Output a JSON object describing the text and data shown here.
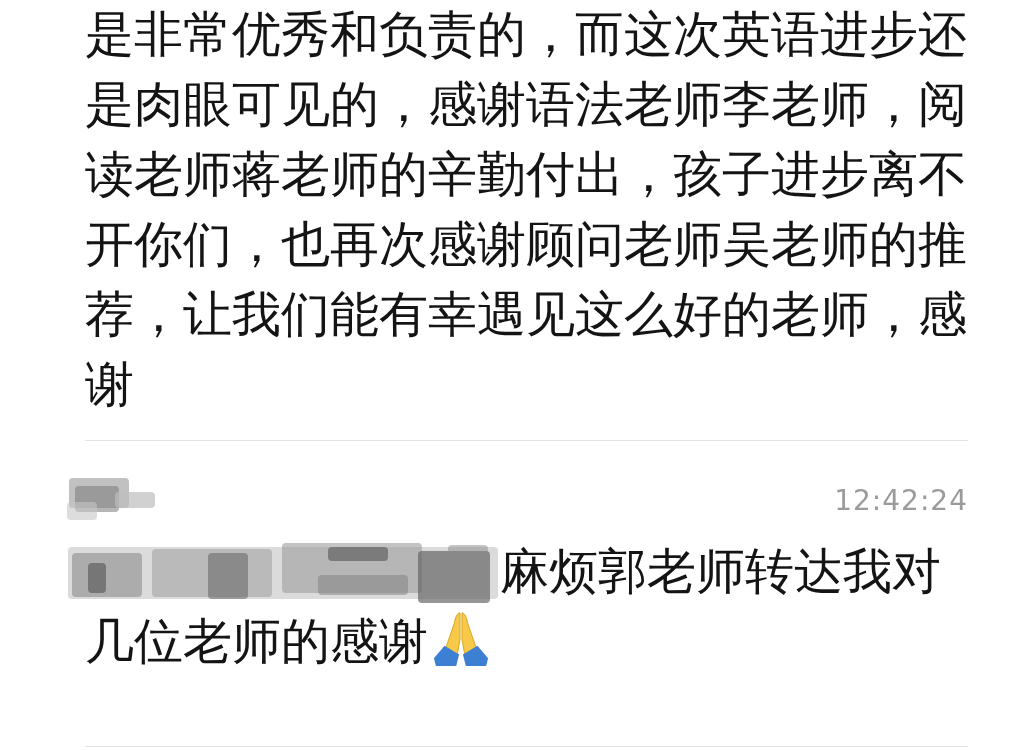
{
  "messages": [
    {
      "kind": "continuation",
      "text": "是非常优秀和负责的，而这次英语进步还是肉眼可见的，感谢语法老师李老师，阅读老师蒋老师的辛勤付出，孩子进步离不开你们，也再次感谢顾问老师吴老师的推荐，让我们能有幸遇见这么好的老师，感谢"
    },
    {
      "kind": "with_header",
      "sender_redacted": true,
      "time": "12:42:24",
      "text_redacted": true,
      "text": "麻烦郭老师转达我对几位老师的感谢",
      "emoji": true
    }
  ]
}
